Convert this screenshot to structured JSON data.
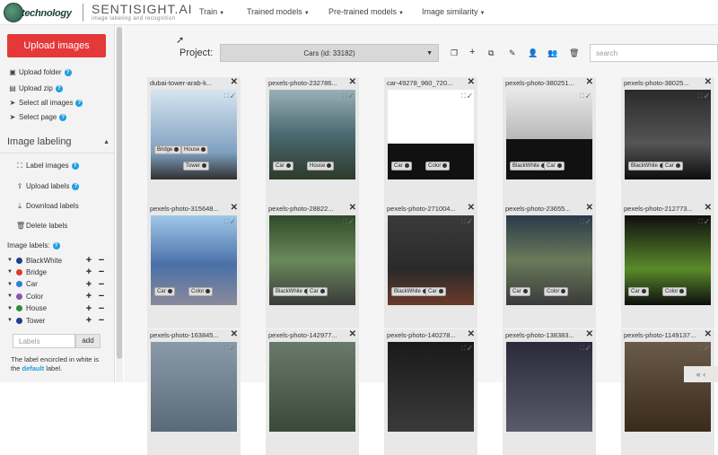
{
  "header": {
    "logo_text": "technology",
    "brand": "SENTISIGHT.AI",
    "tagline": "image labeling and recognition",
    "nav": [
      {
        "label": "Train"
      },
      {
        "label": "Trained models"
      },
      {
        "label": "Pre-trained models"
      },
      {
        "label": "Image similarity"
      }
    ]
  },
  "sidebar": {
    "upload_images": "Upload images",
    "links": [
      {
        "label": "Upload folder"
      },
      {
        "label": "Upload zip"
      },
      {
        "label": "Select all images"
      },
      {
        "label": "Select page"
      }
    ],
    "section_title": "Image labeling",
    "labeling_links": [
      {
        "label": "Label images"
      },
      {
        "label": "Upload labels"
      },
      {
        "label": "Download labels"
      },
      {
        "label": "Delete labels"
      }
    ],
    "image_labels_title": "Image labels:",
    "labels": [
      {
        "name": "BlackWhite",
        "color": "#1f3f8f"
      },
      {
        "name": "Bridge",
        "color": "#e23a2a"
      },
      {
        "name": "Car",
        "color": "#2a82d8"
      },
      {
        "name": "Color",
        "color": "#8a55b0"
      },
      {
        "name": "House",
        "color": "#2e8b3a"
      },
      {
        "name": "Tower",
        "color": "#1f3f8f"
      }
    ],
    "labels_placeholder": "Labels",
    "add_label": "add",
    "note_before": "The label encircled in white is the ",
    "note_default": "default",
    "note_after": " label."
  },
  "toolbar": {
    "project_label": "Project:",
    "project_value": "Cars (id: 33182)",
    "search_placeholder": "search"
  },
  "images": [
    {
      "title": "dubai-tower-arab-k...",
      "tags": [
        "Bridge",
        "House",
        "Tower"
      ]
    },
    {
      "title": "pexels-photo-232786...",
      "tags": [
        "Car",
        "House"
      ]
    },
    {
      "title": "car-49278_960_720...",
      "tags": [
        "Car",
        "Color"
      ]
    },
    {
      "title": "pexels-photo-380251...",
      "tags": [
        "BlackWhite",
        "Car"
      ]
    },
    {
      "title": "pexels-photo-38025...",
      "tags": [
        "BlackWhite",
        "Car"
      ]
    },
    {
      "title": "pexels-photo-315648...",
      "tags": [
        "Car",
        "Color"
      ]
    },
    {
      "title": "pexels-photo-28822...",
      "tags": [
        "BlackWhite",
        "Car"
      ]
    },
    {
      "title": "pexels-photo-271004...",
      "tags": [
        "BlackWhite",
        "Car"
      ]
    },
    {
      "title": "pexels-photo-23655...",
      "tags": [
        "Car",
        "Color"
      ]
    },
    {
      "title": "pexels-photo-212773...",
      "tags": [
        "Car",
        "Color"
      ]
    },
    {
      "title": "pexels-photo-163845...",
      "tags": []
    },
    {
      "title": "pexels-photo-142977...",
      "tags": []
    },
    {
      "title": "pexels-photo-140278...",
      "tags": []
    },
    {
      "title": "pexels-photo-138383...",
      "tags": []
    },
    {
      "title": "pexels-photo-1149137...",
      "tags": []
    }
  ]
}
